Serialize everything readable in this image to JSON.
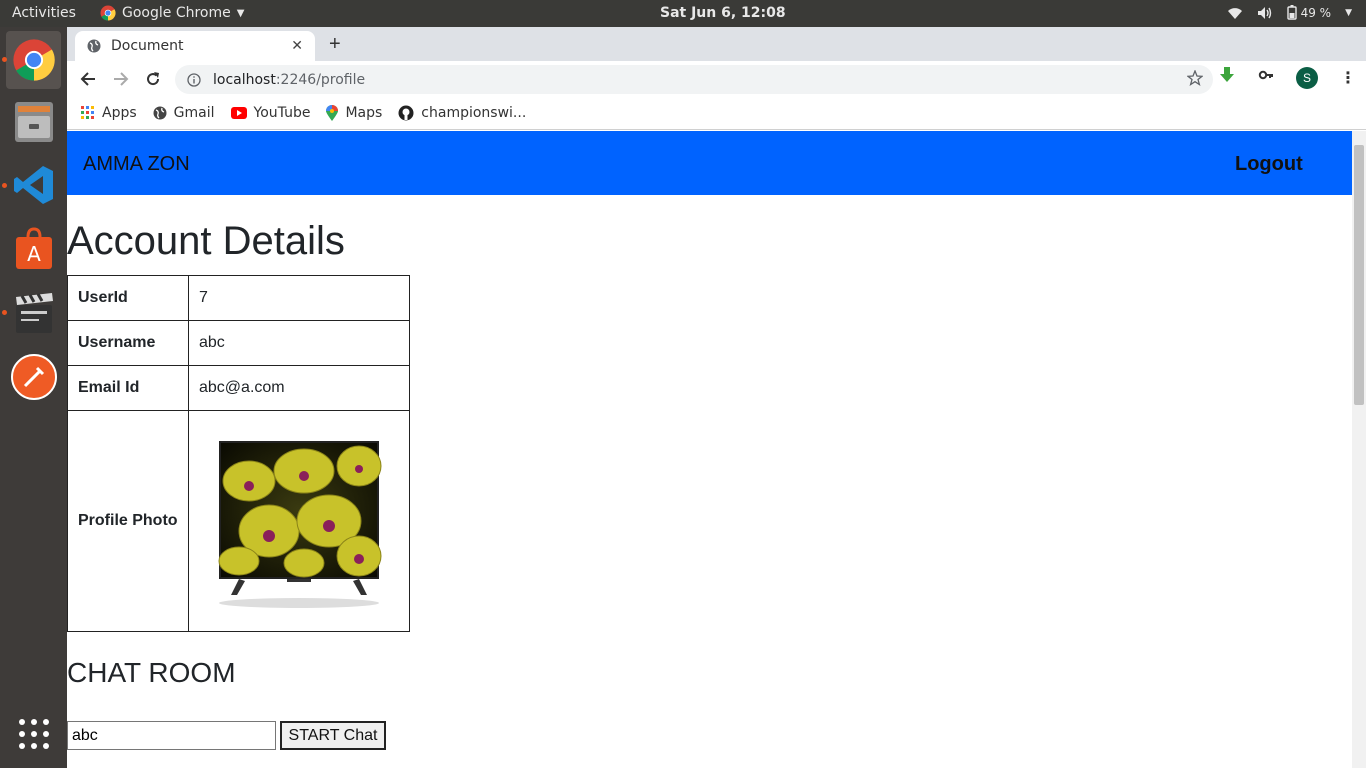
{
  "system_bar": {
    "activities": "Activities",
    "app_name": "Google Chrome",
    "clock": "Sat Jun  6, 12:08",
    "battery": "49 %"
  },
  "browser": {
    "tab_title": "Document",
    "url_host": "localhost",
    "url_path": ":2246/profile",
    "profile_initial": "S",
    "bookmarks": [
      "Apps",
      "Gmail",
      "YouTube",
      "Maps",
      "championswi..."
    ]
  },
  "page": {
    "brand": "AMMA ZON",
    "logout": "Logout",
    "heading": "Account Details",
    "rows": [
      {
        "label": "UserId",
        "value": "7"
      },
      {
        "label": "Username",
        "value": "abc"
      },
      {
        "label": "Email Id",
        "value": "abc@a.com"
      }
    ],
    "photo_label": "Profile Photo",
    "chat_heading": "CHAT ROOM",
    "chat_input_value": "abc",
    "chat_button": "START Chat"
  },
  "colors": {
    "navbar": "#0063ff",
    "topbar": "#3a3a37",
    "dock": "#3e3b39"
  }
}
